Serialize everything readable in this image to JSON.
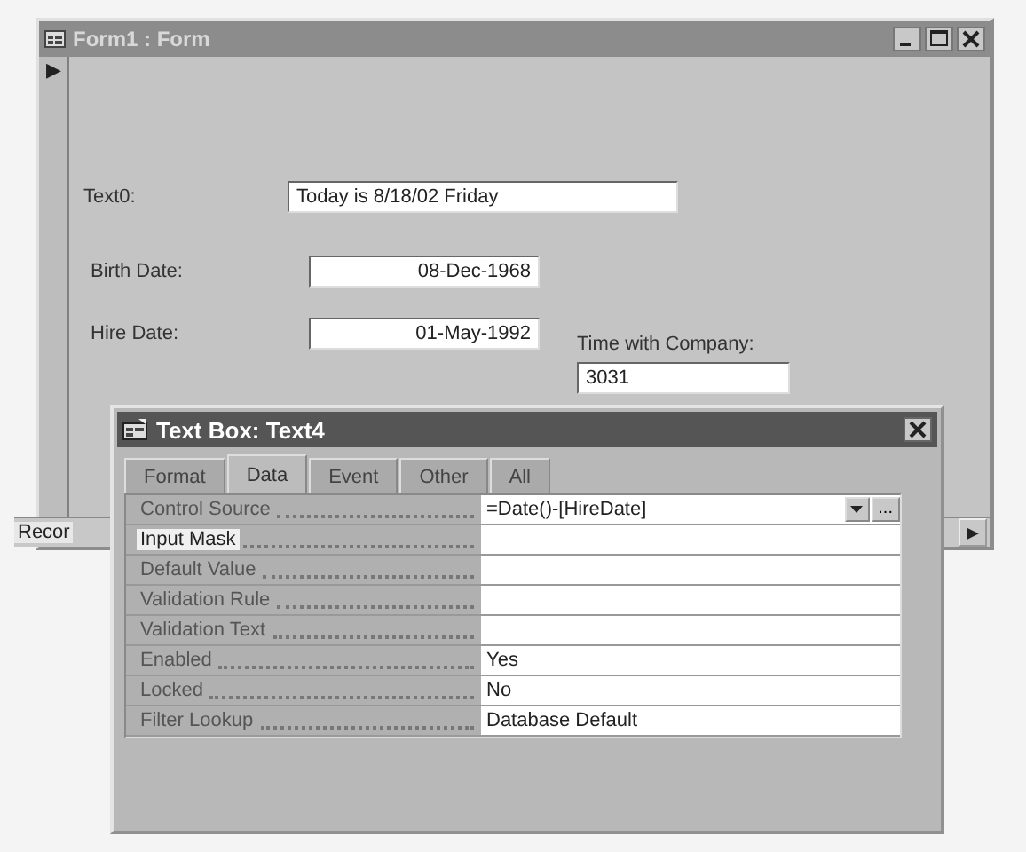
{
  "form_window": {
    "title": "Form1 : Form",
    "record_selector": "▶",
    "fields": [
      {
        "label": "Text0:",
        "value": "Today is 8/18/02 Friday",
        "kind": "text"
      },
      {
        "label": "Birth Date:",
        "value": "08-Dec-1968",
        "kind": "date"
      },
      {
        "label": "Hire Date:",
        "value": "01-May-1992",
        "kind": "date"
      }
    ],
    "time_with_company": {
      "label": "Time with Company:",
      "value": "3031"
    },
    "record_nav": {
      "label": "Recor",
      "next_button": "▶"
    }
  },
  "property_sheet": {
    "title": "Text Box: Text4",
    "tabs": [
      {
        "label": "Format",
        "selected": false
      },
      {
        "label": "Data",
        "selected": true
      },
      {
        "label": "Event",
        "selected": false
      },
      {
        "label": "Other",
        "selected": false
      },
      {
        "label": "All",
        "selected": false
      }
    ],
    "properties": [
      {
        "name": "Control Source",
        "value": "=Date()-[HireDate]",
        "kind": "expression",
        "builder_button": "...",
        "selected": false
      },
      {
        "name": "Input Mask",
        "kind": "plain",
        "selected": true
      },
      {
        "name": "Default Value",
        "kind": "plain",
        "selected": false
      },
      {
        "name": "Validation Rule",
        "kind": "plain",
        "selected": false
      },
      {
        "name": "Validation Text",
        "kind": "plain",
        "selected": false
      },
      {
        "name": "Enabled",
        "value": "Yes",
        "kind": "plain",
        "selected": false
      },
      {
        "name": "Locked",
        "value": "No",
        "kind": "plain",
        "selected": false
      },
      {
        "name": "Filter Lookup",
        "value": "Database Default",
        "kind": "plain",
        "selected": false
      }
    ]
  }
}
